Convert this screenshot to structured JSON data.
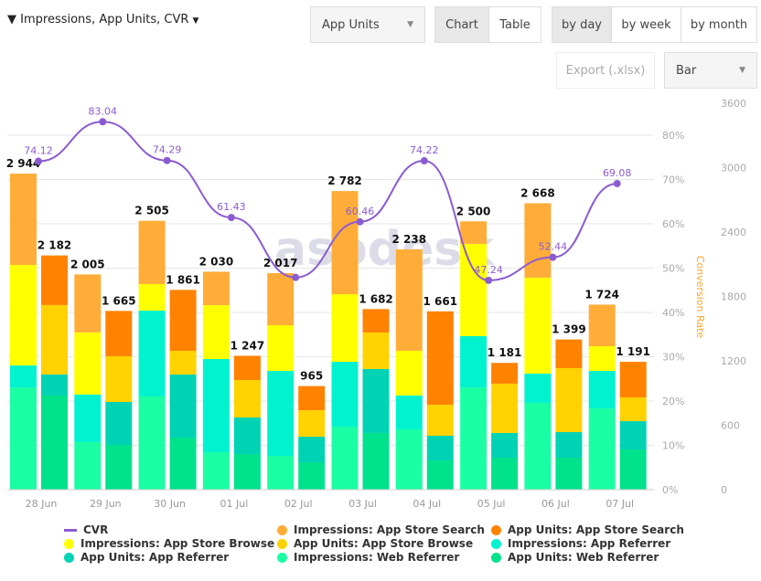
{
  "header": {
    "metric_selector": "Impressions, App Units, CVR",
    "filter_icon": "funnel-icon",
    "metric_dropdown": "App Units",
    "view_chart": "Chart",
    "view_table": "Table",
    "by_day": "by day",
    "by_week": "by week",
    "by_month": "by month",
    "export": "Export (.xlsx)",
    "chart_type": "Bar"
  },
  "watermark": "asodesk",
  "chart_data": {
    "type": "bar",
    "stacked": true,
    "categories": [
      "28 Jun",
      "29 Jun",
      "30 Jun",
      "01 Jul",
      "02 Jul",
      "03 Jul",
      "04 Jul",
      "05 Jul",
      "06 Jul",
      "07 Jul"
    ],
    "y_right": {
      "range": [
        0,
        3600
      ],
      "ticks": [
        0,
        600,
        1200,
        1800,
        2400,
        3000,
        3600
      ]
    },
    "y_left": {
      "label": "Conversion Rate",
      "range": [
        0,
        80
      ],
      "ticks": [
        "0%",
        "10%",
        "20%",
        "30%",
        "40%",
        "50%",
        "60%",
        "70%",
        "80%"
      ]
    },
    "grid": true,
    "legend_placement": "bottom",
    "impressions": {
      "totals": [
        2944,
        2005,
        2505,
        2030,
        2017,
        2782,
        2238,
        2500,
        2668,
        1724
      ],
      "series": [
        {
          "name": "Impressions: Web Referrer",
          "color": "#1affa3",
          "values": [
            953,
            443,
            868,
            349,
            315,
            587,
            562,
            953,
            809,
            757
          ]
        },
        {
          "name": "Impressions: App Referrer",
          "color": "#00f2cf",
          "values": [
            204,
            443,
            800,
            868,
            791,
            604,
            315,
            477,
            272,
            349
          ]
        },
        {
          "name": "Impressions: App Store Browse",
          "color": "#ffff00",
          "values": [
            936,
            579,
            247,
            502,
            426,
            630,
            417,
            860,
            894,
            230
          ]
        },
        {
          "name": "Impressions: App Store Search",
          "color": "#ffad38",
          "values": [
            851,
            540,
            590,
            311,
            485,
            961,
            944,
            210,
            693,
            388
          ]
        }
      ]
    },
    "app_units": {
      "totals": [
        2182,
        1665,
        1861,
        1247,
        965,
        1682,
        1661,
        1181,
        1399,
        1191
      ],
      "series": [
        {
          "name": "App Units: Web Referrer",
          "color": "#00e28c",
          "values": [
            877,
            417,
            485,
            332,
            255,
            528,
            272,
            298,
            298,
            374
          ]
        },
        {
          "name": "App Units: App Referrer",
          "color": "#00d2b4",
          "values": [
            196,
            400,
            587,
            340,
            238,
            596,
            230,
            230,
            238,
            264
          ]
        },
        {
          "name": "App Units: App Store Browse",
          "color": "#ffd200",
          "values": [
            647,
            426,
            221,
            349,
            247,
            340,
            289,
            460,
            596,
            221
          ]
        },
        {
          "name": "App Units: App Store Search",
          "color": "#ff8200",
          "values": [
            462,
            422,
            568,
            226,
            225,
            218,
            870,
            193,
            267,
            332
          ]
        }
      ]
    },
    "cvr": {
      "name": "CVR",
      "color": "#8b5cd1",
      "values": [
        74.12,
        83.04,
        74.29,
        61.43,
        47.9,
        60.46,
        74.22,
        47.24,
        52.44,
        69.08
      ],
      "labels": [
        "74.12",
        "83.04",
        "74.29",
        "61.43",
        "",
        "60.46",
        "74.22",
        "47.24",
        "52.44",
        "69.08"
      ]
    }
  },
  "legend": [
    "CVR",
    "Impressions: App Store Search",
    "App Units: App Store Search",
    "Impressions: App Store Browse",
    "App Units: App Store Browse",
    "Impressions: App Referrer",
    "App Units: App Referrer",
    "Impressions: Web Referrer",
    "App Units: Web Referrer"
  ],
  "legend_colors": [
    "#8b5cd1",
    "#ffad38",
    "#ff8200",
    "#ffff00",
    "#ffd200",
    "#00f2cf",
    "#00d2b4",
    "#1affa3",
    "#00e28c"
  ]
}
